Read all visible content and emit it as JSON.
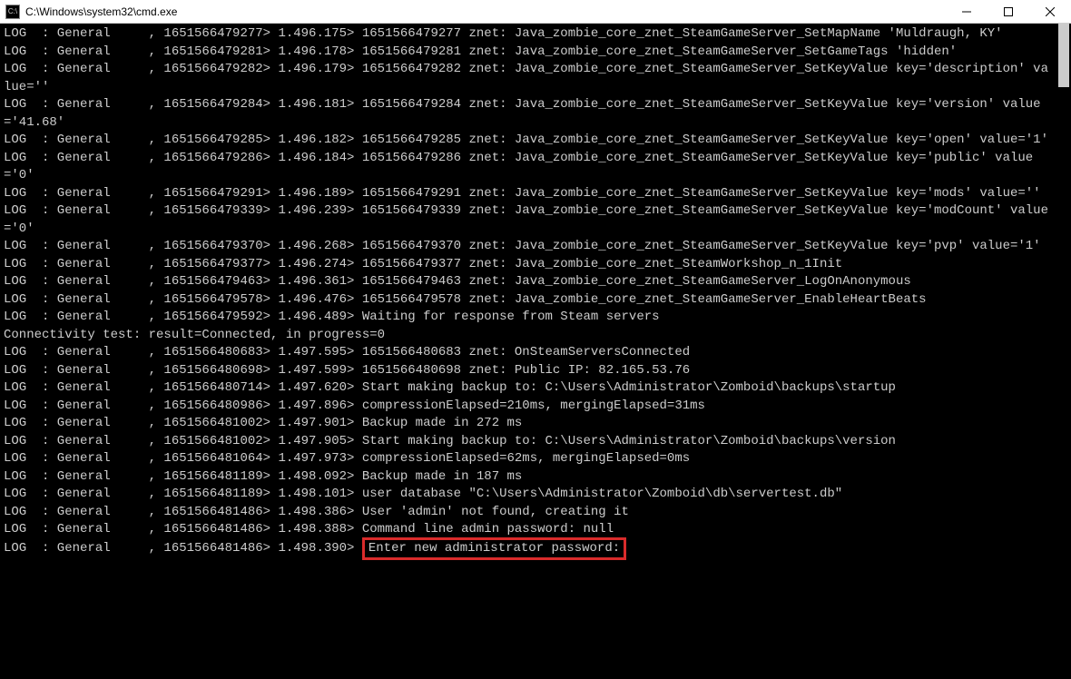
{
  "window": {
    "title": "C:\\Windows\\system32\\cmd.exe",
    "icon_label": "C:\\"
  },
  "log_lines": [
    "LOG  : General     , 1651566479277> 1.496.175> 1651566479277 znet: Java_zombie_core_znet_SteamGameServer_SetMapName 'Muldraugh, KY'",
    "LOG  : General     , 1651566479281> 1.496.178> 1651566479281 znet: Java_zombie_core_znet_SteamGameServer_SetGameTags 'hidden'",
    "LOG  : General     , 1651566479282> 1.496.179> 1651566479282 znet: Java_zombie_core_znet_SteamGameServer_SetKeyValue key='description' value=''",
    "LOG  : General     , 1651566479284> 1.496.181> 1651566479284 znet: Java_zombie_core_znet_SteamGameServer_SetKeyValue key='version' value='41.68'",
    "LOG  : General     , 1651566479285> 1.496.182> 1651566479285 znet: Java_zombie_core_znet_SteamGameServer_SetKeyValue key='open' value='1'",
    "LOG  : General     , 1651566479286> 1.496.184> 1651566479286 znet: Java_zombie_core_znet_SteamGameServer_SetKeyValue key='public' value='0'",
    "LOG  : General     , 1651566479291> 1.496.189> 1651566479291 znet: Java_zombie_core_znet_SteamGameServer_SetKeyValue key='mods' value=''",
    "LOG  : General     , 1651566479339> 1.496.239> 1651566479339 znet: Java_zombie_core_znet_SteamGameServer_SetKeyValue key='modCount' value='0'",
    "LOG  : General     , 1651566479370> 1.496.268> 1651566479370 znet: Java_zombie_core_znet_SteamGameServer_SetKeyValue key='pvp' value='1'",
    "LOG  : General     , 1651566479377> 1.496.274> 1651566479377 znet: Java_zombie_core_znet_SteamWorkshop_n_1Init",
    "LOG  : General     , 1651566479463> 1.496.361> 1651566479463 znet: Java_zombie_core_znet_SteamGameServer_LogOnAnonymous",
    "LOG  : General     , 1651566479578> 1.496.476> 1651566479578 znet: Java_zombie_core_znet_SteamGameServer_EnableHeartBeats",
    "LOG  : General     , 1651566479592> 1.496.489> Waiting for response from Steam servers",
    "Connectivity test: result=Connected, in progress=0",
    "LOG  : General     , 1651566480683> 1.497.595> 1651566480683 znet: OnSteamServersConnected",
    "LOG  : General     , 1651566480698> 1.497.599> 1651566480698 znet: Public IP: 82.165.53.76",
    "LOG  : General     , 1651566480714> 1.497.620> Start making backup to: C:\\Users\\Administrator\\Zomboid\\backups\\startup",
    "LOG  : General     , 1651566480986> 1.497.896> compressionElapsed=210ms, mergingElapsed=31ms",
    "LOG  : General     , 1651566481002> 1.497.901> Backup made in 272 ms",
    "LOG  : General     , 1651566481002> 1.497.905> Start making backup to: C:\\Users\\Administrator\\Zomboid\\backups\\version",
    "LOG  : General     , 1651566481064> 1.497.973> compressionElapsed=62ms, mergingElapsed=0ms",
    "LOG  : General     , 1651566481189> 1.498.092> Backup made in 187 ms",
    "LOG  : General     , 1651566481189> 1.498.101> user database \"C:\\Users\\Administrator\\Zomboid\\db\\servertest.db\"",
    "LOG  : General     , 1651566481486> 1.498.386> User 'admin' not found, creating it",
    "LOG  : General     , 1651566481486> 1.498.388> Command line admin password: null"
  ],
  "prompt_line": {
    "prefix": "LOG  : General     , 1651566481486> 1.498.390>",
    "highlighted": "Enter new administrator password:"
  }
}
